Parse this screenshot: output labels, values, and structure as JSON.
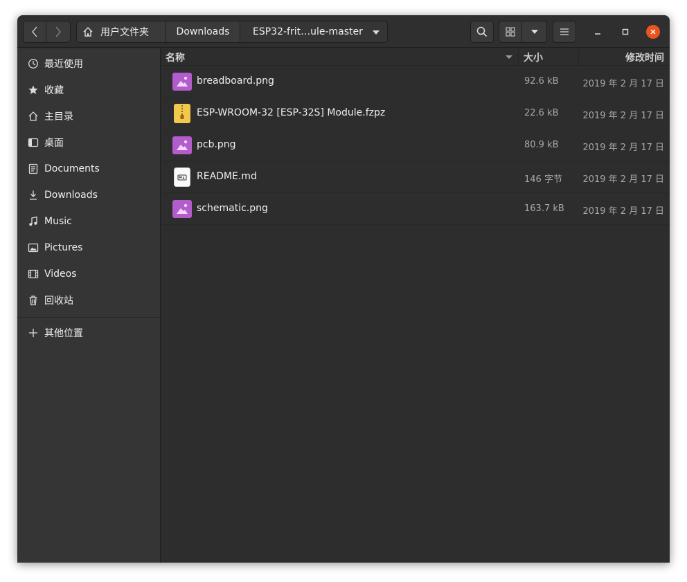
{
  "toolbar": {
    "breadcrumbs": [
      "用户文件夹",
      "Downloads",
      "ESP32-frit…ule-master"
    ]
  },
  "sidebar": {
    "items": [
      {
        "label": "最近使用",
        "icon": "clock-icon"
      },
      {
        "label": "收藏",
        "icon": "star-icon"
      },
      {
        "label": "主目录",
        "icon": "home-icon"
      },
      {
        "label": "桌面",
        "icon": "desktop-icon"
      },
      {
        "label": "Documents",
        "icon": "document-icon"
      },
      {
        "label": "Downloads",
        "icon": "download-icon"
      },
      {
        "label": "Music",
        "icon": "music-icon"
      },
      {
        "label": "Pictures",
        "icon": "picture-icon"
      },
      {
        "label": "Videos",
        "icon": "video-icon"
      },
      {
        "label": "回收站",
        "icon": "trash-icon"
      }
    ],
    "other_locations": {
      "label": "其他位置",
      "icon": "plus-icon"
    }
  },
  "columns": {
    "name": "名称",
    "size": "大小",
    "modified": "修改时间"
  },
  "files": [
    {
      "name": "breadboard.png",
      "size": "92.6 kB",
      "modified": "2019 年 2 月 17 日",
      "icon": "image-file-icon"
    },
    {
      "name": "ESP-WROOM-32 [ESP-32S] Module.fzpz",
      "size": "22.6 kB",
      "modified": "2019 年 2 月 17 日",
      "icon": "archive-file-icon"
    },
    {
      "name": "pcb.png",
      "size": "80.9 kB",
      "modified": "2019 年 2 月 17 日",
      "icon": "image-file-icon"
    },
    {
      "name": "README.md",
      "size": "146 字节",
      "modified": "2019 年 2 月 17 日",
      "icon": "markdown-file-icon"
    },
    {
      "name": "schematic.png",
      "size": "163.7 kB",
      "modified": "2019 年 2 月 17 日",
      "icon": "image-file-icon"
    }
  ],
  "colors": {
    "accent_close": "#e95420",
    "image_icon": "#b35ccc",
    "archive_icon": "#f2c94c"
  }
}
